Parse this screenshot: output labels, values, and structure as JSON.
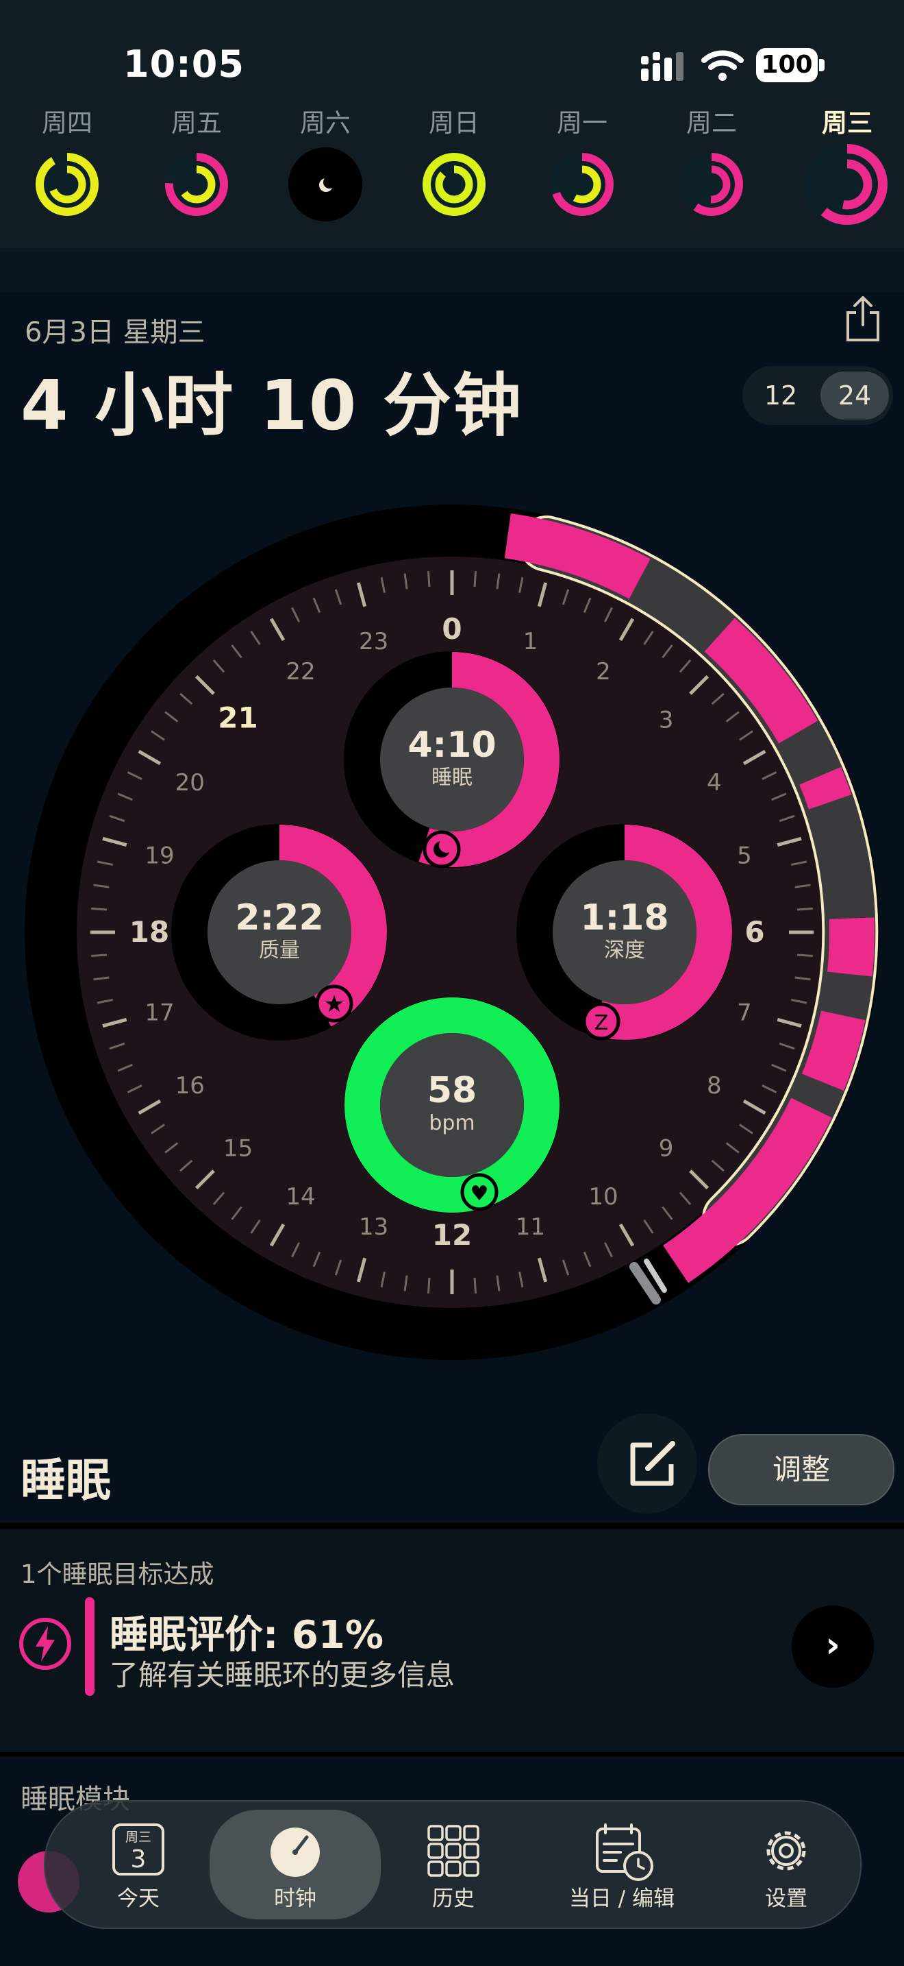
{
  "status_bar": {
    "time": "10:05",
    "battery": "100"
  },
  "week": [
    {
      "label": "周四",
      "current": false
    },
    {
      "label": "周五",
      "current": false
    },
    {
      "label": "周六",
      "current": false
    },
    {
      "label": "周日",
      "current": false
    },
    {
      "label": "周一",
      "current": false
    },
    {
      "label": "周二",
      "current": false
    },
    {
      "label": "周三",
      "current": true
    }
  ],
  "header": {
    "date": "6月3日 星期三",
    "duration": "4 小时 10 分钟",
    "format_options": [
      "12",
      "24"
    ],
    "selected_format": "24"
  },
  "dial": {
    "hour_labels": [
      "0",
      "1",
      "2",
      "3",
      "4",
      "5",
      "6",
      "7",
      "8",
      "9",
      "10",
      "11",
      "12",
      "13",
      "14",
      "15",
      "16",
      "17",
      "18",
      "19",
      "20",
      "21",
      "22",
      "23"
    ],
    "stats": [
      {
        "id": "sleep",
        "value": "4:10",
        "label": "睡眠",
        "icon": "moon-icon",
        "progress": 0.55
      },
      {
        "id": "quality",
        "value": "2:22",
        "label": "质量",
        "icon": "star-icon",
        "progress": 0.42
      },
      {
        "id": "deep",
        "value": "1:18",
        "label": "深度",
        "icon": "z-icon",
        "progress": 0.55
      },
      {
        "id": "heart",
        "value": "58",
        "label": "bpm",
        "icon": "heart-icon",
        "progress": 1.0
      }
    ],
    "colors": {
      "sleep": "#ec2a8c",
      "heart": "#12ee56",
      "accent": "#f4ecc0"
    }
  },
  "sleep_section": {
    "title": "睡眠",
    "adjust_label": "调整",
    "goal_text": "1个睡眠目标达成",
    "score_text": "睡眠评价: 61%",
    "score_sub": "了解有关睡眠环的更多信息",
    "modules_label": "睡眠模块"
  },
  "tabs": [
    {
      "label": "今天",
      "icon": "calendar-day-icon",
      "badge_top": "周三",
      "badge_num": "3"
    },
    {
      "label": "时钟",
      "icon": "clock-icon"
    },
    {
      "label": "历史",
      "icon": "grid-icon"
    },
    {
      "label": "当日 / 编辑",
      "icon": "calendar-clock-icon"
    },
    {
      "label": "设置",
      "icon": "gear-icon"
    }
  ],
  "selected_tab": "时钟"
}
